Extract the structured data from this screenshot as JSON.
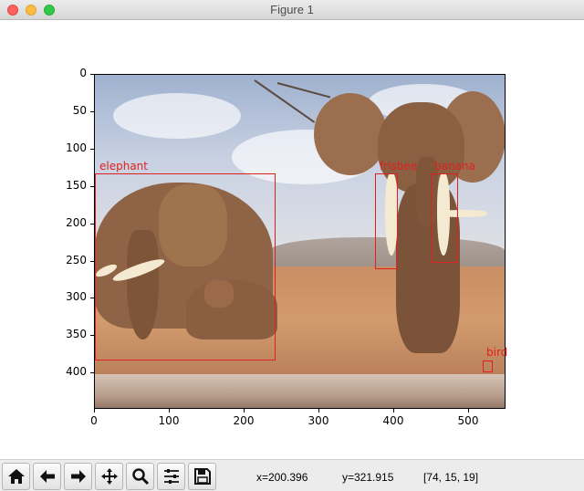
{
  "window": {
    "title": "Figure 1"
  },
  "axes": {
    "y_ticks": [
      "0",
      "50",
      "100",
      "150",
      "200",
      "250",
      "300",
      "350",
      "400"
    ],
    "x_ticks": [
      "0",
      "100",
      "200",
      "300",
      "400",
      "500"
    ]
  },
  "detections": [
    {
      "label": "elephant",
      "color": "#e02020"
    },
    {
      "label": "frisbee",
      "color": "#e02020"
    },
    {
      "label": "banana",
      "color": "#e02020"
    },
    {
      "label": "bird",
      "color": "#e02020"
    }
  ],
  "toolbar": {
    "buttons": [
      {
        "name": "home-button",
        "icon": "home-icon"
      },
      {
        "name": "back-button",
        "icon": "arrow-left-icon"
      },
      {
        "name": "forward-button",
        "icon": "arrow-right-icon"
      },
      {
        "name": "pan-button",
        "icon": "move-icon"
      },
      {
        "name": "zoom-button",
        "icon": "magnifier-icon"
      },
      {
        "name": "configure-subplots-button",
        "icon": "sliders-icon"
      },
      {
        "name": "save-button",
        "icon": "floppy-icon"
      }
    ],
    "status_x": "x=200.396",
    "status_y": "y=321.915",
    "status_rgb": "[74, 15, 19]"
  }
}
